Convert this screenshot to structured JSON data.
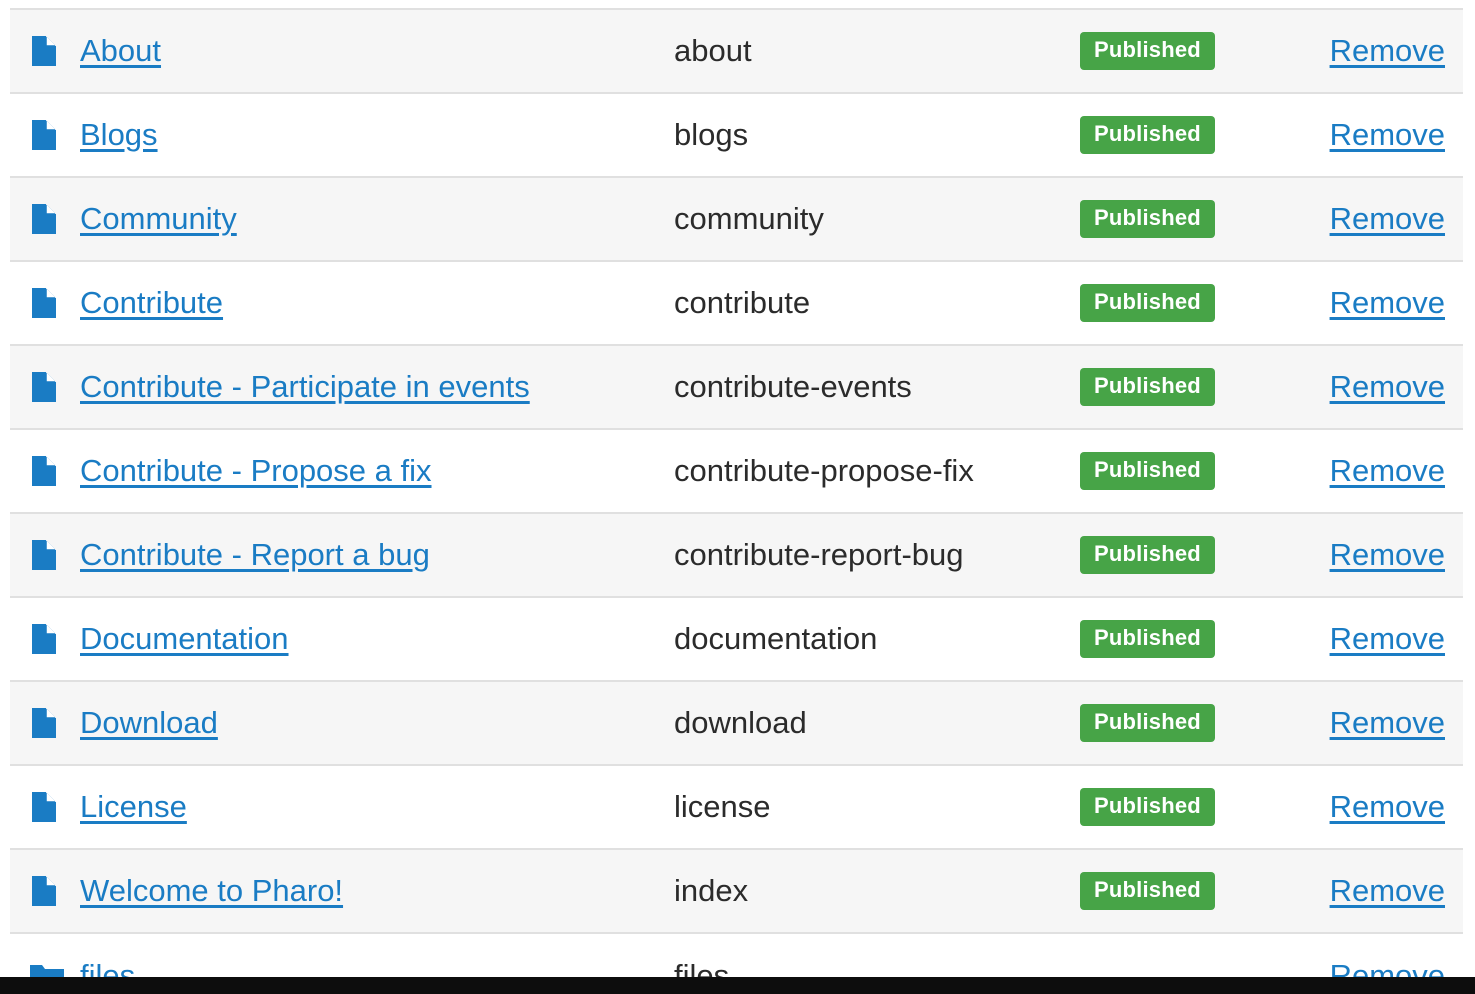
{
  "colors": {
    "link": "#1a7cc4",
    "badge": "#47a447",
    "row_alt": "#f6f6f6",
    "border": "#e0e0e0"
  },
  "rows": [
    {
      "title": "About",
      "slug": "about",
      "status": "Published",
      "action": "Remove",
      "icon": "file-icon"
    },
    {
      "title": "Blogs",
      "slug": "blogs",
      "status": "Published",
      "action": "Remove",
      "icon": "file-icon"
    },
    {
      "title": "Community",
      "slug": "community",
      "status": "Published",
      "action": "Remove",
      "icon": "file-icon"
    },
    {
      "title": "Contribute",
      "slug": "contribute",
      "status": "Published",
      "action": "Remove",
      "icon": "file-icon"
    },
    {
      "title": "Contribute - Participate in events",
      "slug": "contribute-events",
      "status": "Published",
      "action": "Remove",
      "icon": "file-icon"
    },
    {
      "title": "Contribute - Propose a fix",
      "slug": "contribute-propose-fix",
      "status": "Published",
      "action": "Remove",
      "icon": "file-icon"
    },
    {
      "title": "Contribute - Report a bug",
      "slug": "contribute-report-bug",
      "status": "Published",
      "action": "Remove",
      "icon": "file-icon"
    },
    {
      "title": "Documentation",
      "slug": "documentation",
      "status": "Published",
      "action": "Remove",
      "icon": "file-icon"
    },
    {
      "title": "Download",
      "slug": "download",
      "status": "Published",
      "action": "Remove",
      "icon": "file-icon"
    },
    {
      "title": "License",
      "slug": "license",
      "status": "Published",
      "action": "Remove",
      "icon": "file-icon"
    },
    {
      "title": "Welcome to Pharo!",
      "slug": "index",
      "status": "Published",
      "action": "Remove",
      "icon": "file-icon"
    },
    {
      "title": "files",
      "slug": "files",
      "status": "",
      "action": "Remove",
      "icon": "folder-icon"
    }
  ]
}
